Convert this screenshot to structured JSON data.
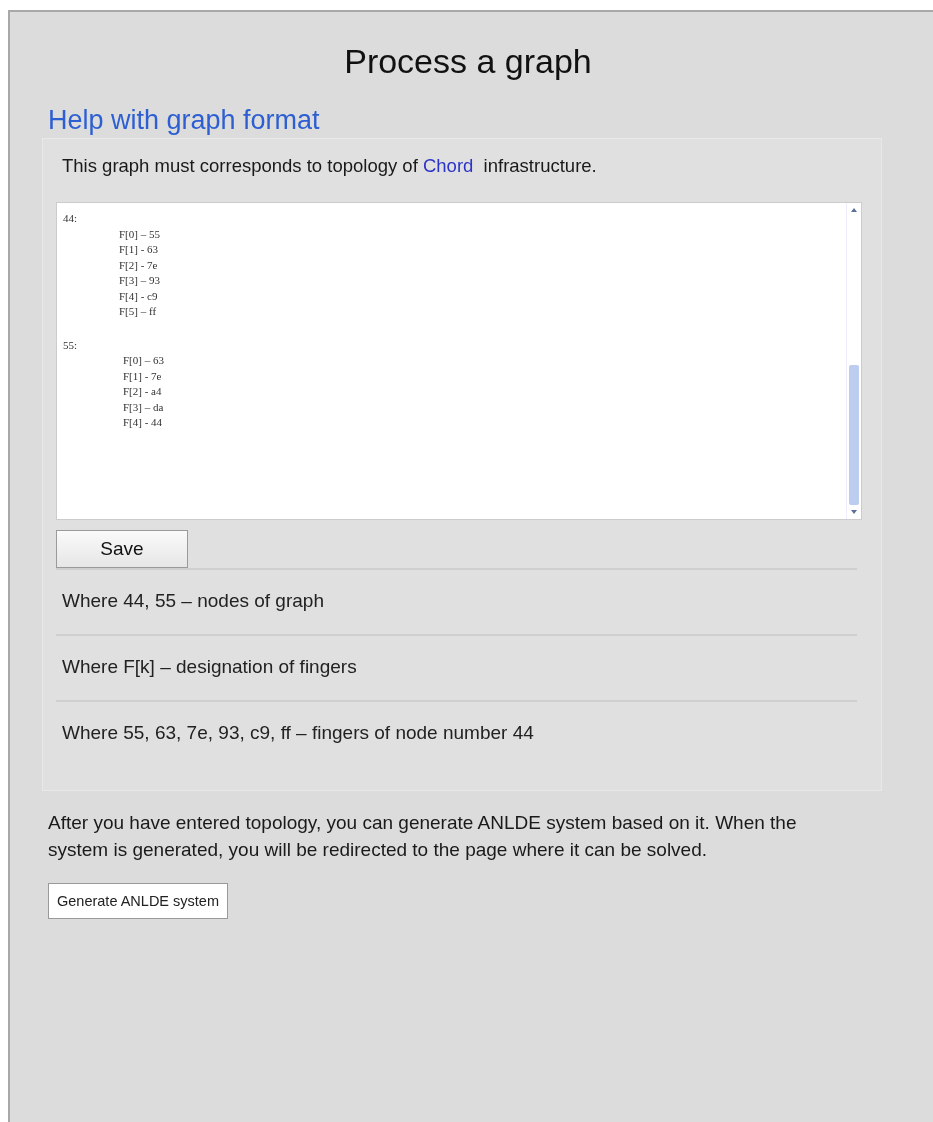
{
  "title": "Process a graph",
  "help_link": "Help with graph format",
  "intro": {
    "before": "This graph must corresponds to topology of",
    "link": "Chord",
    "after": "infrastructure."
  },
  "editor": {
    "nodes": [
      {
        "label": "44:",
        "fingers": [
          "F[0] – 55",
          "F[1] - 63",
          "F[2] - 7e",
          "F[3] – 93",
          "F[4] - c9",
          "F[5] – ff"
        ]
      },
      {
        "label": "55:",
        "fingers": [
          "F[0] – 63",
          "F[1] - 7e",
          "F[2] - a4",
          "F[3] – da",
          "F[4] - 44"
        ]
      }
    ]
  },
  "save_button": "Save",
  "notes": [
    "Where 44, 55 – nodes of graph",
    "Where F[k] – designation of fingers",
    "Where 55, 63, 7e, 93, c9, ff – fingers of node number 44"
  ],
  "paragraph": "After you have entered topology, you can generate ANLDE system based on it. When the system is generated, you will be redirected to the page where it can be solved.",
  "generate_button": "Generate ANLDE system"
}
